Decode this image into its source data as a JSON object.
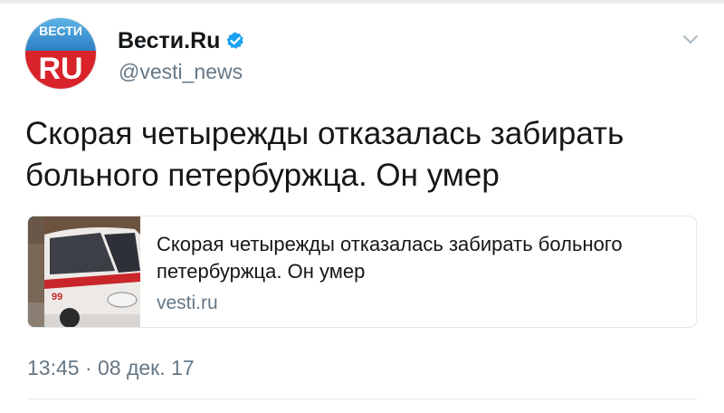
{
  "account": {
    "display_name": "Вести.Ru",
    "handle": "@vesti_news",
    "verified": true,
    "avatar_top_text": "ВЕСТИ",
    "avatar_bottom_text": "RU"
  },
  "tweet": {
    "text": "Скорая четырежды отказалась забирать больного петербуржца. Он умер",
    "timestamp": "13:45 · 08 дек. 17"
  },
  "card": {
    "title": "Скорая четырежды отказалась забирать больного петербуржца. Он умер",
    "domain": "vesti.ru",
    "image_number": "99"
  },
  "icons": {
    "verified": "verified-badge-icon",
    "menu": "chevron-down-icon"
  },
  "colors": {
    "verified_blue": "#1da1f2",
    "text": "#14171a",
    "secondary_text": "#657786",
    "avatar_blue": "#2c7fc5",
    "avatar_red": "#d8232a"
  }
}
